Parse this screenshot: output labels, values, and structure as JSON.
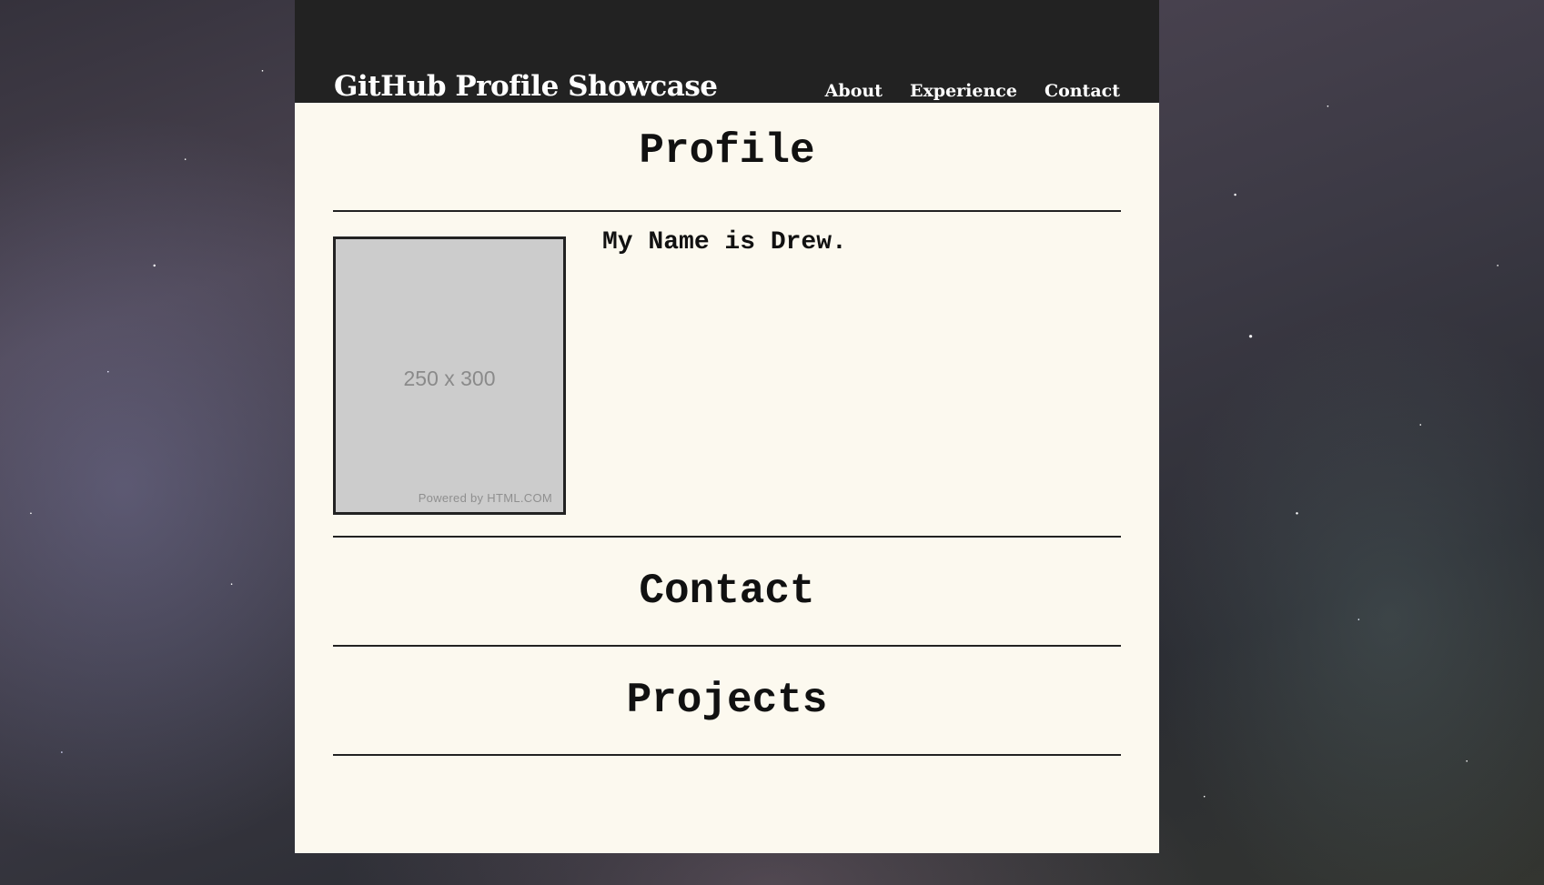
{
  "header": {
    "title": "GitHub Profile Showcase",
    "nav": [
      {
        "label": "About"
      },
      {
        "label": "Experience"
      },
      {
        "label": "Contact"
      }
    ]
  },
  "profile": {
    "heading": "Profile",
    "intro": "My Name is Drew.",
    "avatar": {
      "size_label": "250 x 300",
      "powered_by": "Powered by HTML.COM"
    }
  },
  "contact": {
    "heading": "Contact"
  },
  "projects": {
    "heading": "Projects"
  },
  "colors": {
    "header_bg": "#222222",
    "content_bg": "#fcf9ef",
    "divider": "#222222",
    "placeholder_bg": "#cccccc"
  }
}
